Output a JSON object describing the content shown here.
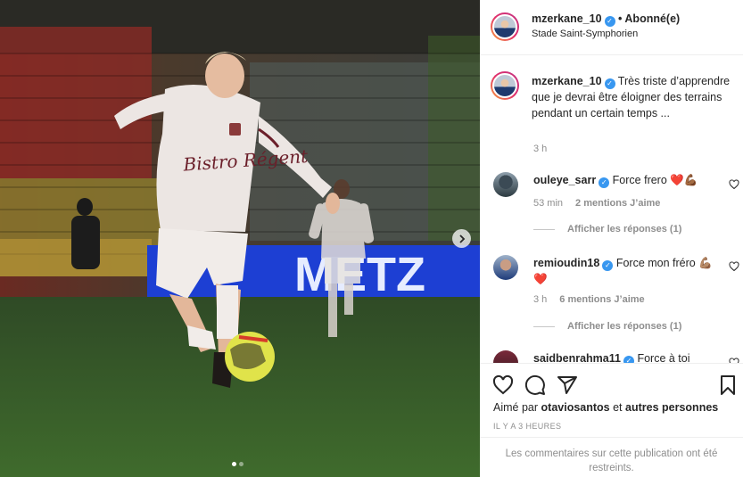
{
  "post": {
    "author": "mzerkane_10",
    "follow_state": "• Abonné(e)",
    "location": "Stade Saint-Symphorien",
    "caption": "Très triste d’apprendre que je devrai être éloigner des terrains pendant un certain temps ...",
    "caption_time": "3 h",
    "shirt_text": "Bistro Régent",
    "banner_text": "METZ",
    "carousel_dots": 2
  },
  "comments": [
    {
      "user": "ouleye_sarr",
      "text": "Force frero ❤️💪🏾",
      "time": "53 min",
      "likes": "2 mentions J’aime",
      "replies": "Afficher les réponses (1)"
    },
    {
      "user": "remioudin18",
      "text": "Force mon fréro 💪🏽",
      "text2": "❤️",
      "time": "3 h",
      "likes": "6 mentions J’aime",
      "replies": "Afficher les réponses (1)"
    },
    {
      "user": "saidbenrahma11",
      "text": "Force à toi"
    }
  ],
  "footer": {
    "liked_prefix": "Aimé par",
    "liked_user": "otaviosantos",
    "liked_middle": "et",
    "liked_others": "autres personnes",
    "time_ago": "IL Y A 3 HEURES",
    "restricted_notice": "Les commentaires sur cette publication ont été restreints."
  },
  "icons": {
    "verified": "verified-badge-icon",
    "like": "heart-icon",
    "comment": "comment-icon",
    "share": "share-icon",
    "save": "bookmark-icon",
    "next": "chevron-right-icon"
  },
  "colors": {
    "verified": "#3897f0",
    "muted": "#8e8e8e",
    "text": "#262626",
    "shirt": "#ece6e3",
    "shirt_text": "#6b1f2a",
    "banner": "#1d3fd3"
  }
}
